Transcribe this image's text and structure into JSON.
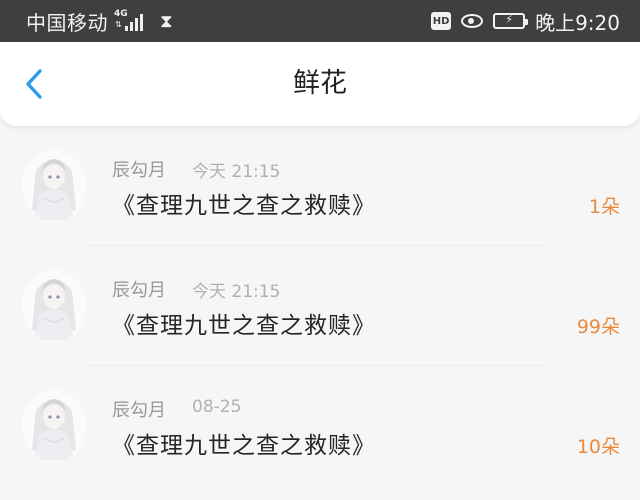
{
  "status_bar": {
    "carrier": "中国移动",
    "network": "4G",
    "hd": "HD",
    "time": "晚上9:20"
  },
  "header": {
    "title": "鲜花",
    "back_icon": "chevron-left-icon"
  },
  "colors": {
    "accent": "#2f9be8",
    "count": "#ea8a3f"
  },
  "gifts": [
    {
      "name": "辰勾月",
      "time": "今天 21:15",
      "work": "《查理九世之查之救赎》",
      "count": "1朵"
    },
    {
      "name": "辰勾月",
      "time": "今天 21:15",
      "work": "《查理九世之查之救赎》",
      "count": "99朵"
    },
    {
      "name": "辰勾月",
      "time": "08-25",
      "work": "《查理九世之查之救赎》",
      "count": "10朵"
    }
  ]
}
